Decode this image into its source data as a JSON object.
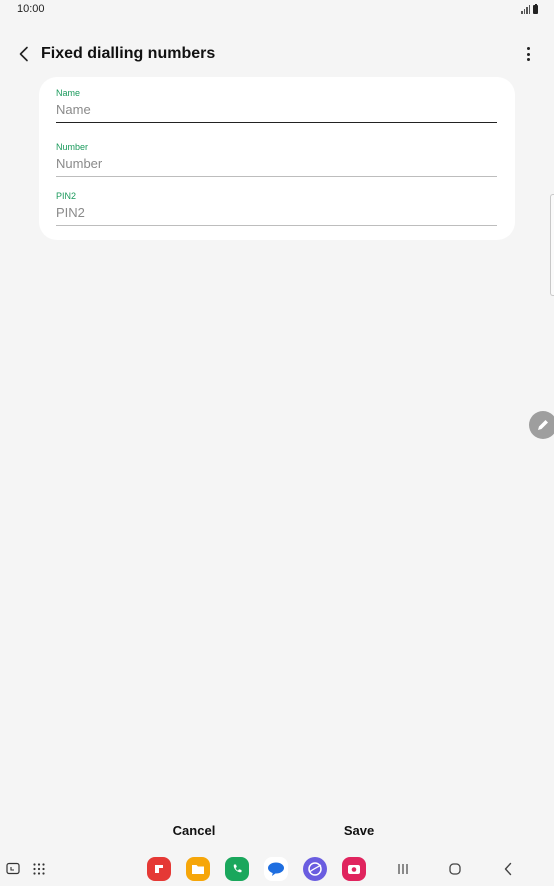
{
  "status_bar": {
    "time": "10:00"
  },
  "header": {
    "title": "Fixed dialling numbers"
  },
  "form": {
    "name": {
      "label": "Name",
      "placeholder": "Name",
      "value": ""
    },
    "number": {
      "label": "Number",
      "placeholder": "Number",
      "value": ""
    },
    "pin2": {
      "label": "PIN2",
      "placeholder": "PIN2",
      "value": ""
    }
  },
  "actions": {
    "cancel_label": "Cancel",
    "save_label": "Save"
  },
  "taskbar": {
    "apps": [
      {
        "icon": "flipboard-icon",
        "color": "#e53935"
      },
      {
        "icon": "my-files-icon",
        "color": "#f6a609"
      },
      {
        "icon": "phone-icon",
        "color": "#1aa75c"
      },
      {
        "icon": "messages-icon",
        "color": "#1e6ee0"
      },
      {
        "icon": "internet-icon",
        "color": "#6a5de0"
      },
      {
        "icon": "camera-icon",
        "color": "#e0245e"
      }
    ]
  }
}
